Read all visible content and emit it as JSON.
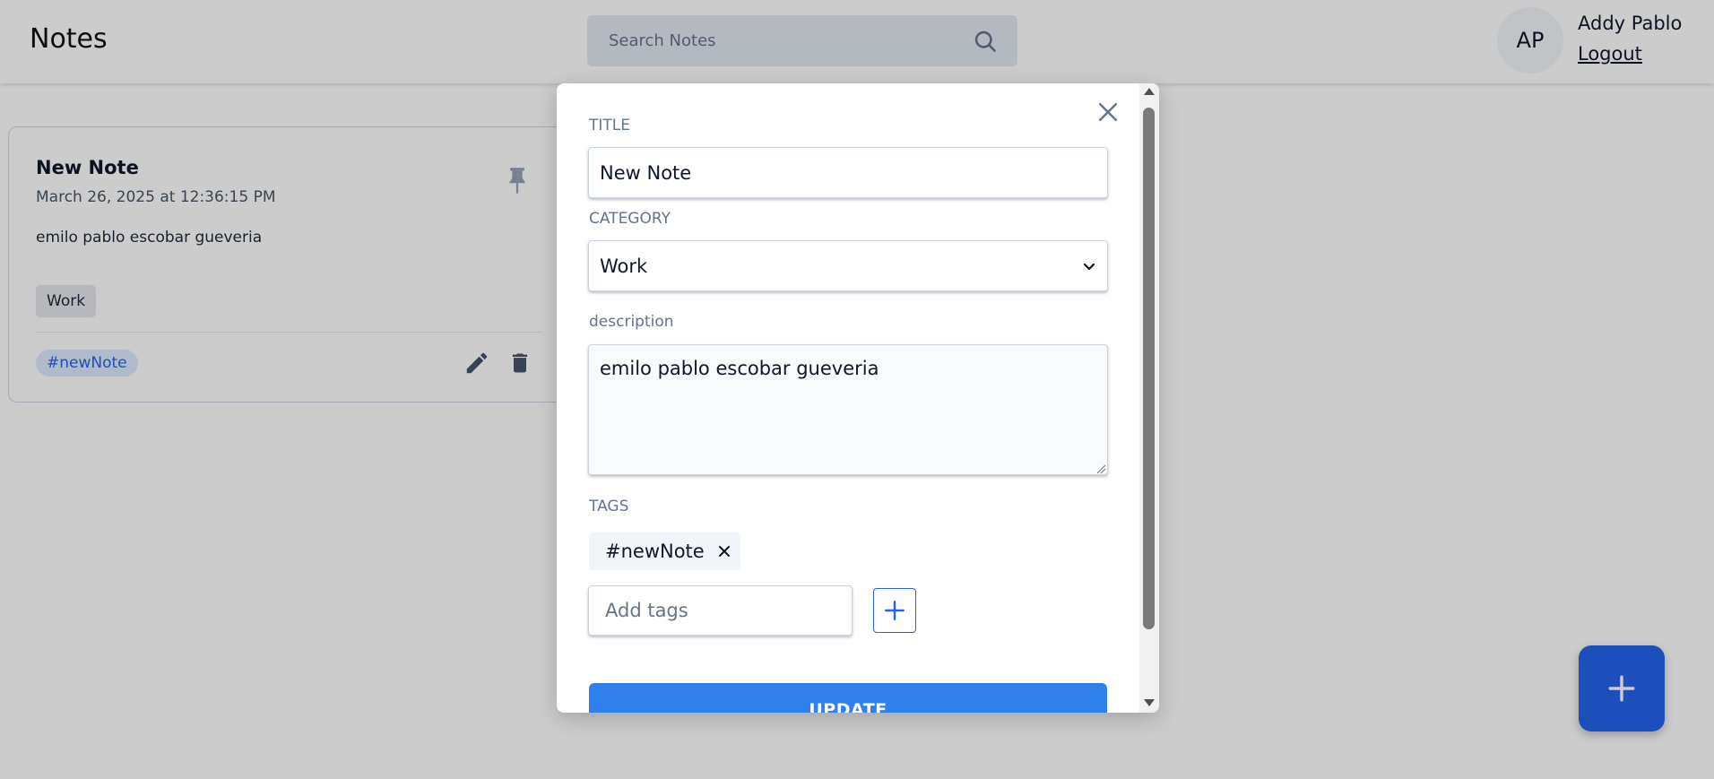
{
  "header": {
    "app_title": "Notes",
    "search_placeholder": "Search Notes",
    "user": {
      "initials": "AP",
      "name": "Addy Pablo",
      "logout_label": "Logout"
    }
  },
  "note_card": {
    "title": "New Note",
    "date": "March 26, 2025 at 12:36:15 PM",
    "description": "emilo pablo escobar gueveria",
    "category": "Work",
    "tag": "#newNote"
  },
  "modal": {
    "title_label": "TITLE",
    "title_value": "New Note",
    "category_label": "CATEGORY",
    "category_value": "Work",
    "description_label": "description",
    "description_value": "emilo pablo escobar gueveria",
    "tags_label": "TAGS",
    "tags": [
      "#newNote"
    ],
    "add_tags_placeholder": "Add tags",
    "submit_label": "UPDATE"
  },
  "colors": {
    "primary": "#2563eb",
    "update_button": "#2f80ed",
    "tag_text": "#2563eb",
    "overlay": "rgba(0,0,0,0.2)"
  },
  "icons": [
    "search-icon",
    "pin-icon",
    "edit-icon",
    "delete-icon",
    "close-icon",
    "chevron-down-icon",
    "tag-remove-icon",
    "plus-icon"
  ]
}
